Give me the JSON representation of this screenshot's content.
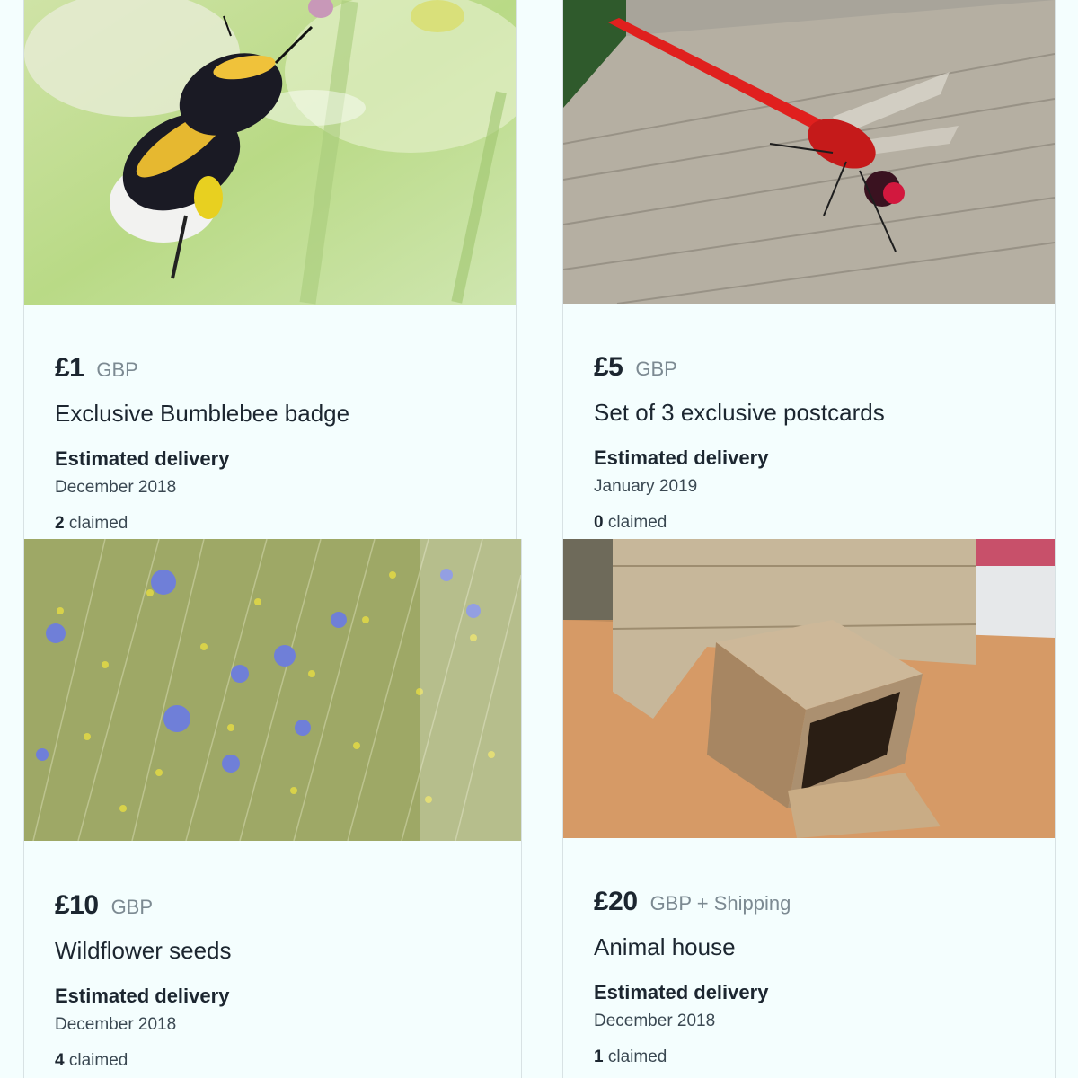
{
  "rewards": [
    {
      "price": "£1",
      "currency": "GBP",
      "title": "Exclusive Bumblebee badge",
      "delivery_label": "Estimated delivery",
      "delivery_date": "December 2018",
      "claimed_count": "2",
      "claimed_text": "claimed",
      "image": "bumblebee-photo"
    },
    {
      "price": "£5",
      "currency": "GBP",
      "title": "Set of 3 exclusive postcards",
      "delivery_label": "Estimated delivery",
      "delivery_date": "January 2019",
      "claimed_count": "0",
      "claimed_text": "claimed",
      "image": "red-dragonfly-photo"
    },
    {
      "price": "£10",
      "currency": "GBP",
      "title": "Wildflower seeds",
      "delivery_label": "Estimated delivery",
      "delivery_date": "December 2018",
      "claimed_count": "4",
      "claimed_text": "claimed",
      "image": "wildflower-meadow-photo"
    },
    {
      "price": "£20",
      "currency": "GBP + Shipping",
      "title": "Animal house",
      "delivery_label": "Estimated delivery",
      "delivery_date": "December 2018",
      "claimed_count": "1",
      "claimed_text": "claimed",
      "image": "wooden-animal-house-photo"
    }
  ],
  "colors": {
    "background": "#f4fefe",
    "text": "#1c2630",
    "muted": "#7c8a92",
    "border": "#d8e2e4"
  }
}
